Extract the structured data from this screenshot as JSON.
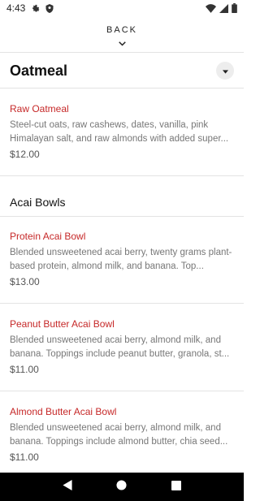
{
  "status_bar": {
    "time": "4:43",
    "left_icons": [
      "gear-icon",
      "shield-icon"
    ],
    "right_icons": [
      "wifi-icon",
      "cell-signal-icon",
      "battery-icon"
    ]
  },
  "header": {
    "back_label": "BACK",
    "back_icon": "chevron-down-icon"
  },
  "category": {
    "title": "Oatmeal",
    "toggle_icon": "caret-down-icon"
  },
  "oatmeal_items": [
    {
      "name": "Raw Oatmeal",
      "description": "Steel-cut oats, raw cashews, dates, vanilla, pink Himalayan salt, and raw almonds with added super...",
      "price": "$12.00"
    }
  ],
  "acai_section": {
    "title": "Acai Bowls",
    "items": [
      {
        "name": "Protein Acai Bowl",
        "description": "Blended unsweetened acai berry, twenty grams plant-based protein, almond milk, and banana. Top...",
        "price": "$13.00"
      },
      {
        "name": "Peanut Butter Acai Bowl",
        "description": "Blended unsweetened acai berry, almond milk, and banana. Toppings include peanut butter, granola, st...",
        "price": "$11.00"
      },
      {
        "name": "Almond Butter Acai Bowl",
        "description": "Blended unsweetened acai berry, almond milk, and banana. Toppings include almond butter, chia seed...",
        "price": "$11.00"
      }
    ]
  },
  "nav_bar": {
    "buttons": [
      "back-triangle-icon",
      "home-circle-icon",
      "recents-square-icon"
    ]
  },
  "colors": {
    "item_name": "#c62828",
    "description": "#777777",
    "divider": "#e3e3e3",
    "nav_bar": "#000000"
  }
}
